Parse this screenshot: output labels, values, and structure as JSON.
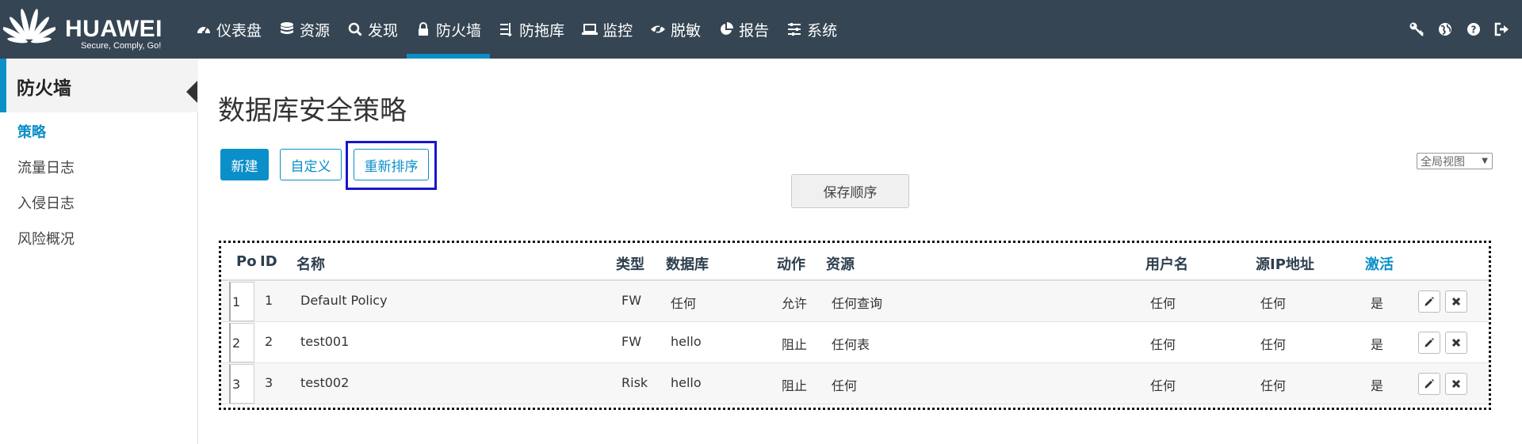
{
  "brand": {
    "name": "HUAWEI",
    "slogan": "Secure, Comply, Go!"
  },
  "colors": {
    "topbar": "#354553",
    "accent": "#0a8fc9",
    "focus": "#1a17c9"
  },
  "nav": [
    {
      "label": "仪表盘",
      "icon": "dashboard-icon"
    },
    {
      "label": "资源",
      "icon": "database-icon"
    },
    {
      "label": "发现",
      "icon": "search-icon"
    },
    {
      "label": "防火墙",
      "icon": "lock-icon",
      "active": true
    },
    {
      "label": "防拖库",
      "icon": "filter-icon"
    },
    {
      "label": "监控",
      "icon": "laptop-icon"
    },
    {
      "label": "脱敏",
      "icon": "eye-slash-icon"
    },
    {
      "label": "报告",
      "icon": "pie-chart-icon"
    },
    {
      "label": "系统",
      "icon": "sliders-icon"
    }
  ],
  "header_tools": [
    "key-icon",
    "globe-icon",
    "help-icon",
    "logout-icon"
  ],
  "sidebar": {
    "title": "防火墙",
    "items": [
      {
        "label": "策略",
        "active": true
      },
      {
        "label": "流量日志"
      },
      {
        "label": "入侵日志"
      },
      {
        "label": "风险概况"
      }
    ]
  },
  "main": {
    "title": "数据库安全策略",
    "buttons": {
      "new": "新建",
      "customize": "自定义",
      "reorder": "重新排序",
      "save_order": "保存顺序"
    },
    "view_select": "全局视图"
  },
  "table": {
    "columns": [
      "Pos",
      "ID",
      "名称",
      "类型",
      "数据库",
      "动作",
      "资源",
      "用户名",
      "源IP地址",
      "激活"
    ],
    "rows": [
      {
        "pos": "1",
        "id": "1",
        "name": "Default Policy",
        "type": "FW",
        "db": "任何",
        "action": "允许",
        "resource": "任何查询",
        "user": "任何",
        "src_ip": "任何",
        "active": "是"
      },
      {
        "pos": "2",
        "id": "2",
        "name": "test001",
        "type": "FW",
        "db": "hello",
        "action": "阻止",
        "resource": "任何表",
        "user": "任何",
        "src_ip": "任何",
        "active": "是"
      },
      {
        "pos": "3",
        "id": "3",
        "name": "test002",
        "type": "Risk",
        "db": "hello",
        "action": "阻止",
        "resource": "任何",
        "user": "任何",
        "src_ip": "任何",
        "active": "是"
      }
    ]
  }
}
